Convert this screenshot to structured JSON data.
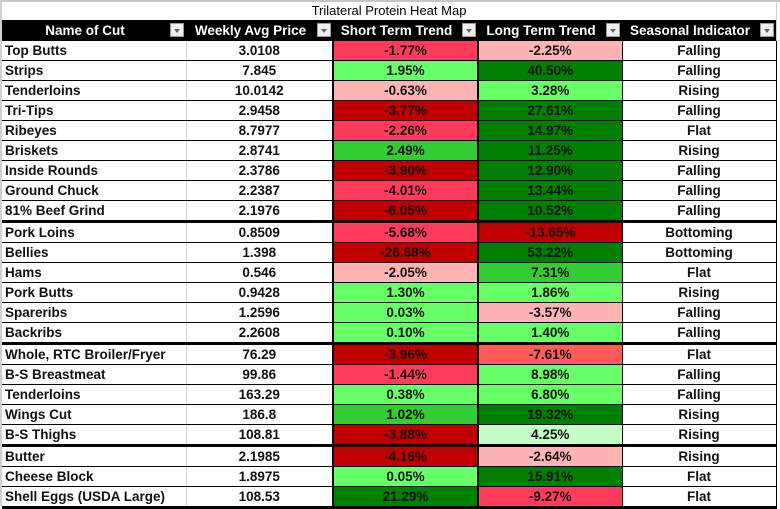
{
  "title": "Trilateral Protein Heat Map",
  "headers": {
    "name": "Name of Cut",
    "price": "Weekly Avg Price",
    "short": "Short Term Trend",
    "long": "Long Term Trend",
    "seasonal": "Seasonal Indicator"
  },
  "colors": {
    "dark_red": "#c00000",
    "red": "#ff3b5c",
    "light_red": "#ffb3b3",
    "medium_red": "#ff5b5b",
    "light_green": "#66ff66",
    "medium_green": "#33cc33",
    "dark_green": "#008000",
    "pale_green": "#c6ffc6"
  },
  "rows": [
    {
      "name": "Top Butts",
      "price": "3.0108",
      "short": "-1.77%",
      "short_color": "c-r",
      "long": "-2.25%",
      "long_color": "c-lr",
      "seasonal": "Falling",
      "group_end": false
    },
    {
      "name": "Strips",
      "price": "7.845",
      "short": "1.95%",
      "short_color": "c-lg",
      "long": "40.50%",
      "long_color": "c-dg",
      "seasonal": "Falling",
      "group_end": false
    },
    {
      "name": "Tenderloins",
      "price": "10.0142",
      "short": "-0.63%",
      "short_color": "c-lr",
      "long": "3.28%",
      "long_color": "c-lg",
      "seasonal": "Rising",
      "group_end": false
    },
    {
      "name": "Tri-Tips",
      "price": "2.9458",
      "short": "-3.77%",
      "short_color": "c-dr",
      "long": "27.61%",
      "long_color": "c-dg",
      "seasonal": "Falling",
      "group_end": false
    },
    {
      "name": "Ribeyes",
      "price": "8.7977",
      "short": "-2.26%",
      "short_color": "c-r",
      "long": "14.97%",
      "long_color": "c-dg",
      "seasonal": "Flat",
      "group_end": false
    },
    {
      "name": "Briskets",
      "price": "2.8741",
      "short": "2.49%",
      "short_color": "c-mg",
      "long": "11.25%",
      "long_color": "c-dg",
      "seasonal": "Rising",
      "group_end": false
    },
    {
      "name": "Inside Rounds",
      "price": "2.3786",
      "short": "-3.90%",
      "short_color": "c-dr",
      "long": "12.90%",
      "long_color": "c-dg",
      "seasonal": "Falling",
      "group_end": false
    },
    {
      "name": "Ground Chuck",
      "price": "2.2387",
      "short": "-4.01%",
      "short_color": "c-r",
      "long": "13.44%",
      "long_color": "c-dg",
      "seasonal": "Falling",
      "group_end": false
    },
    {
      "name": "81% Beef Grind",
      "price": "2.1976",
      "short": "-6.05%",
      "short_color": "c-dr",
      "long": "10.52%",
      "long_color": "c-dg",
      "seasonal": "Falling",
      "group_end": true
    },
    {
      "name": "Pork Loins",
      "price": "0.8509",
      "short": "-5.68%",
      "short_color": "c-r",
      "long": "-13.65%",
      "long_color": "c-dr",
      "seasonal": "Bottoming",
      "group_end": false
    },
    {
      "name": "Bellies",
      "price": "1.398",
      "short": "-26.68%",
      "short_color": "c-dr",
      "long": "53.22%",
      "long_color": "c-dg",
      "seasonal": "Bottoming",
      "group_end": false
    },
    {
      "name": "Hams",
      "price": "0.546",
      "short": "-2.05%",
      "short_color": "c-lr",
      "long": "7.31%",
      "long_color": "c-mg",
      "seasonal": "Flat",
      "group_end": false
    },
    {
      "name": "Pork Butts",
      "price": "0.9428",
      "short": "1.30%",
      "short_color": "c-lg",
      "long": "1.86%",
      "long_color": "c-lg",
      "seasonal": "Rising",
      "group_end": false
    },
    {
      "name": "Spareribs",
      "price": "1.2596",
      "short": "0.03%",
      "short_color": "c-lg",
      "long": "-3.57%",
      "long_color": "c-lr",
      "seasonal": "Falling",
      "group_end": false
    },
    {
      "name": "Backribs",
      "price": "2.2608",
      "short": "0.10%",
      "short_color": "c-lg",
      "long": "1.40%",
      "long_color": "c-lg",
      "seasonal": "Falling",
      "group_end": true
    },
    {
      "name": "Whole, RTC Broiler/Fryer",
      "price": "76.29",
      "short": "-3.96%",
      "short_color": "c-dr",
      "long": "-7.61%",
      "long_color": "c-mr",
      "seasonal": "Flat",
      "group_end": false
    },
    {
      "name": "B-S Breastmeat",
      "price": "99.86",
      "short": "-1.44%",
      "short_color": "c-r",
      "long": "8.98%",
      "long_color": "c-lg",
      "seasonal": "Falling",
      "group_end": false
    },
    {
      "name": "Tenderloins",
      "price": "163.29",
      "short": "0.38%",
      "short_color": "c-lg",
      "long": "6.80%",
      "long_color": "c-lg",
      "seasonal": "Falling",
      "group_end": false
    },
    {
      "name": "Wings Cut",
      "price": "186.8",
      "short": "1.02%",
      "short_color": "c-mg",
      "long": "19.32%",
      "long_color": "c-dg",
      "seasonal": "Rising",
      "group_end": false
    },
    {
      "name": "B-S Thighs",
      "price": "108.81",
      "short": "-3.88%",
      "short_color": "c-dr",
      "long": "4.25%",
      "long_color": "c-pg",
      "seasonal": "Rising",
      "group_end": true
    },
    {
      "name": "Butter",
      "price": "2.1985",
      "short": "-4.16%",
      "short_color": "c-dr",
      "long": "-2.64%",
      "long_color": "c-lr",
      "seasonal": "Rising",
      "group_end": false
    },
    {
      "name": "Cheese Block",
      "price": "1.8975",
      "short": "0.05%",
      "short_color": "c-lg",
      "long": "15.91%",
      "long_color": "c-dg",
      "seasonal": "Flat",
      "group_end": false
    },
    {
      "name": "Shell Eggs (USDA Large)",
      "price": "108.53",
      "short": "21.29%",
      "short_color": "c-dg",
      "long": "-9.27%",
      "long_color": "c-r",
      "seasonal": "Flat",
      "group_end": true
    }
  ]
}
